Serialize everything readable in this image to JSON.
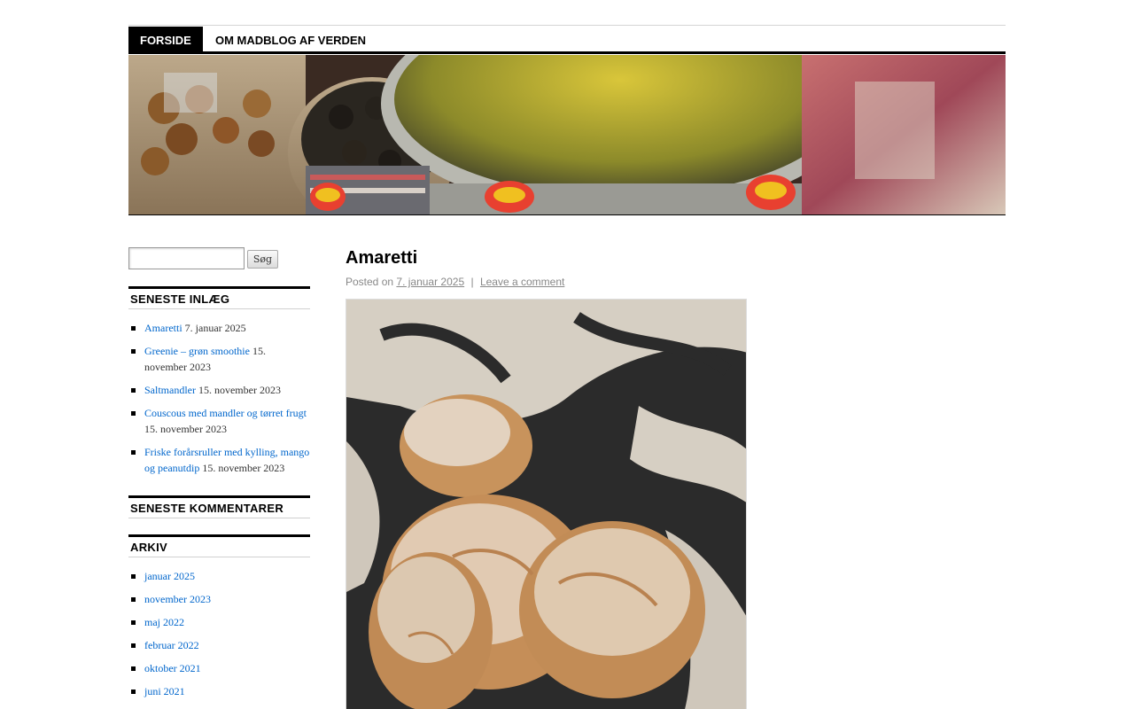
{
  "nav": {
    "items": [
      {
        "label": "FORSIDE",
        "active": true
      },
      {
        "label": "OM MADBLOG AF VERDEN",
        "active": false
      }
    ]
  },
  "search": {
    "value": "",
    "button_label": "Søg"
  },
  "widgets": {
    "recent_posts": {
      "title": "SENESTE INLÆG",
      "items": [
        {
          "link": "Amaretti",
          "date": "7. januar 2025"
        },
        {
          "link": "Greenie – grøn smoothie",
          "date": "15. november 2023"
        },
        {
          "link": "Saltmandler",
          "date": "15. november 2023"
        },
        {
          "link": "Couscous med mandler og tørret frugt",
          "date": "15. november 2023"
        },
        {
          "link": "Friske forårsruller med kylling, mango og peanutdip",
          "date": "15. november 2023"
        }
      ]
    },
    "recent_comments": {
      "title": "SENESTE KOMMENTARER"
    },
    "archive": {
      "title": "ARKIV",
      "items": [
        "januar 2025",
        "november 2023",
        "maj 2022",
        "februar 2022",
        "oktober 2021",
        "juni 2021"
      ]
    }
  },
  "post": {
    "title": "Amaretti",
    "posted_on": "Posted on",
    "date": "7. januar 2025",
    "separator": "|",
    "comment_link": "Leave a comment"
  },
  "colors": {
    "link": "#0066cc",
    "meta": "#888888",
    "nav_active_bg": "#000000"
  }
}
